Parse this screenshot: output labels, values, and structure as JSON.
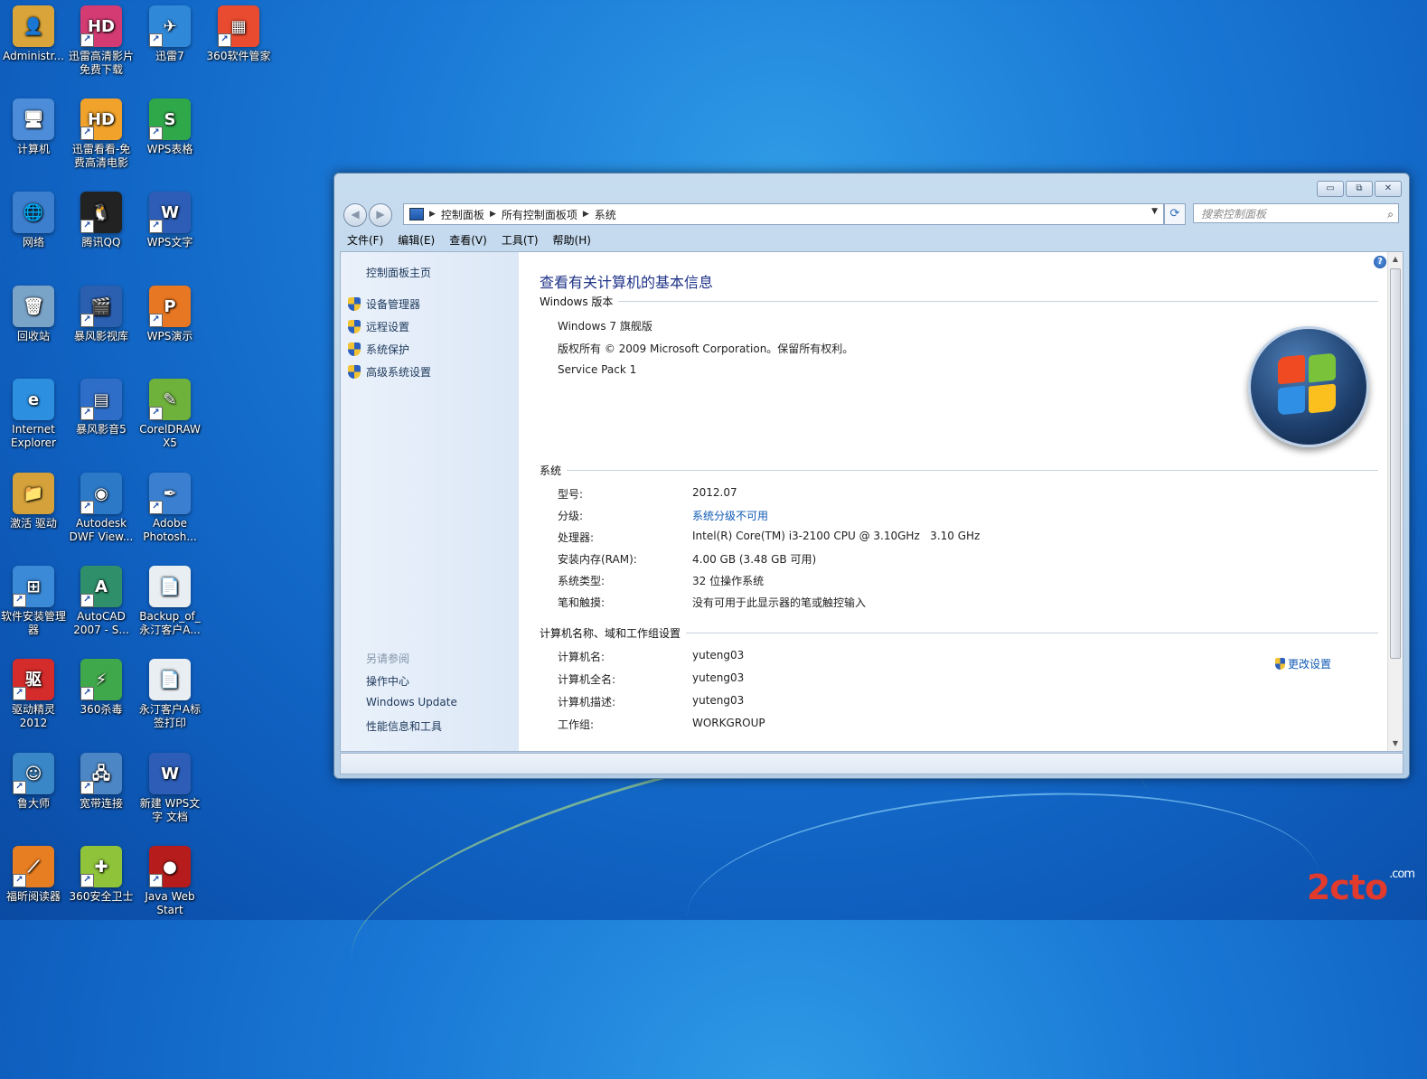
{
  "desktop": {
    "icons": [
      {
        "label": "Administr...",
        "glyph": "👤",
        "color": "#d9a53a",
        "shortcut": false
      },
      {
        "label": "迅雷高清影片\n免费下载",
        "glyph": "HD",
        "color": "#d43b73",
        "shortcut": true
      },
      {
        "label": "迅雷7",
        "glyph": "✈",
        "color": "#2f88d8",
        "shortcut": true
      },
      {
        "label": "360软件管家",
        "glyph": "▦",
        "color": "#e84b2f",
        "shortcut": true
      },
      {
        "label": "计算机",
        "glyph": "🖥",
        "color": "#4c8cd8",
        "shortcut": false
      },
      {
        "label": "迅雷看看-免\n费高清电影",
        "glyph": "HD",
        "color": "#f0a22a",
        "shortcut": true
      },
      {
        "label": "WPS表格",
        "glyph": "S",
        "color": "#2fa84a",
        "shortcut": true
      },
      {
        "label": "网络",
        "glyph": "🌐",
        "color": "#3c7fcf",
        "shortcut": false
      },
      {
        "label": "腾讯QQ",
        "glyph": "🐧",
        "color": "#222222",
        "shortcut": true
      },
      {
        "label": "WPS文字",
        "glyph": "W",
        "color": "#2d5db6",
        "shortcut": true
      },
      {
        "label": "回收站",
        "glyph": "🗑",
        "color": "#7aa3c8",
        "shortcut": false
      },
      {
        "label": "暴风影视库",
        "glyph": "🎬",
        "color": "#2b5fb0",
        "shortcut": true
      },
      {
        "label": "WPS演示",
        "glyph": "P",
        "color": "#e77722",
        "shortcut": true
      },
      {
        "label": "Internet\nExplorer",
        "glyph": "e",
        "color": "#2c8fe0",
        "shortcut": false
      },
      {
        "label": "暴风影音5",
        "glyph": "▤",
        "color": "#2f6ec8",
        "shortcut": true
      },
      {
        "label": "CorelDRAW\nX5",
        "glyph": "✎",
        "color": "#6eb23c",
        "shortcut": true
      },
      {
        "label": "激活 驱动",
        "glyph": "📁",
        "color": "#d4a13a",
        "shortcut": false
      },
      {
        "label": "Autodesk\nDWF View...",
        "glyph": "◉",
        "color": "#2c79c8",
        "shortcut": true
      },
      {
        "label": "Adobe\nPhotosh...",
        "glyph": "✒",
        "color": "#3a7fd0",
        "shortcut": true
      },
      {
        "label": "软件安装管理\n器",
        "glyph": "⊞",
        "color": "#3b8ad8",
        "shortcut": true
      },
      {
        "label": "AutoCAD\n2007 - S...",
        "glyph": "A",
        "color": "#2f8f6b",
        "shortcut": true
      },
      {
        "label": "Backup_of_\n永汀客户A...",
        "glyph": "📄",
        "color": "#e9eef3",
        "shortcut": false
      },
      {
        "label": "驱动精灵\n2012",
        "glyph": "驱",
        "color": "#d42b2b",
        "shortcut": true
      },
      {
        "label": "360杀毒",
        "glyph": "⚡",
        "color": "#3fa84a",
        "shortcut": true
      },
      {
        "label": "永汀客户A标\n签打印",
        "glyph": "📄",
        "color": "#e9eef3",
        "shortcut": false
      },
      {
        "label": "鲁大师",
        "glyph": "☺",
        "color": "#3a87c7",
        "shortcut": true
      },
      {
        "label": "宽带连接",
        "glyph": "🖧",
        "color": "#4d86c4",
        "shortcut": true
      },
      {
        "label": "新建 WPS文\n字 文档",
        "glyph": "W",
        "color": "#2d5db6",
        "shortcut": false
      },
      {
        "label": "福昕阅读器",
        "glyph": "⟋",
        "color": "#e87e22",
        "shortcut": true
      },
      {
        "label": "360安全卫士",
        "glyph": "✚",
        "color": "#8fc43a",
        "shortcut": true
      },
      {
        "label": "Java Web\nStart",
        "glyph": "●",
        "color": "#b61c1c",
        "shortcut": true
      }
    ]
  },
  "window": {
    "controls": {
      "minimize": "▭",
      "maximize": "⧉",
      "close": "✕"
    },
    "nav": {
      "back": "◀",
      "forward": "▶"
    },
    "address": {
      "crumbs": [
        "控制面板",
        "所有控制面板项",
        "系统"
      ],
      "separator": "▶"
    },
    "refresh_icon": "⟳",
    "search": {
      "placeholder": "搜索控制面板",
      "icon": "⌕"
    },
    "menu": [
      "文件(F)",
      "编辑(E)",
      "查看(V)",
      "工具(T)",
      "帮助(H)"
    ],
    "left_pane": {
      "home": "控制面板主页",
      "tasks": [
        "设备管理器",
        "远程设置",
        "系统保护",
        "高级系统设置"
      ],
      "see_also_heading": "另请参阅",
      "see_also": [
        "操作中心",
        "Windows Update",
        "性能信息和工具"
      ]
    },
    "main": {
      "title": "查看有关计算机的基本信息",
      "help_icon": "?",
      "edition_heading": "Windows 版本",
      "edition": [
        "Windows 7 旗舰版",
        "版权所有 © 2009 Microsoft Corporation。保留所有权利。",
        "Service Pack 1"
      ],
      "system_heading": "系统",
      "system_rows": [
        {
          "label": "型号:",
          "value": "2012.07"
        },
        {
          "label": "分级:",
          "value": "系统分级不可用"
        },
        {
          "label": "处理器:",
          "value": "Intel(R) Core(TM) i3-2100 CPU @ 3.10GHz   3.10 GHz"
        },
        {
          "label": "安装内存(RAM):",
          "value": "4.00 GB (3.48 GB 可用)"
        },
        {
          "label": "系统类型:",
          "value": "32 位操作系统"
        },
        {
          "label": "笔和触摸:",
          "value": "没有可用于此显示器的笔或触控输入"
        }
      ],
      "computer_heading": "计算机名称、域和工作组设置",
      "computer_rows": [
        {
          "label": "计算机名:",
          "value": "yuteng03"
        },
        {
          "label": "计算机全名:",
          "value": "yuteng03"
        },
        {
          "label": "计算机描述:",
          "value": "yuteng03"
        },
        {
          "label": "工作组:",
          "value": "WORKGROUP"
        }
      ],
      "change_settings": "更改设置"
    },
    "scroll": {
      "up": "▲",
      "down": "▼"
    }
  },
  "watermark": {
    "main": "2cto",
    "sub": ".com"
  }
}
